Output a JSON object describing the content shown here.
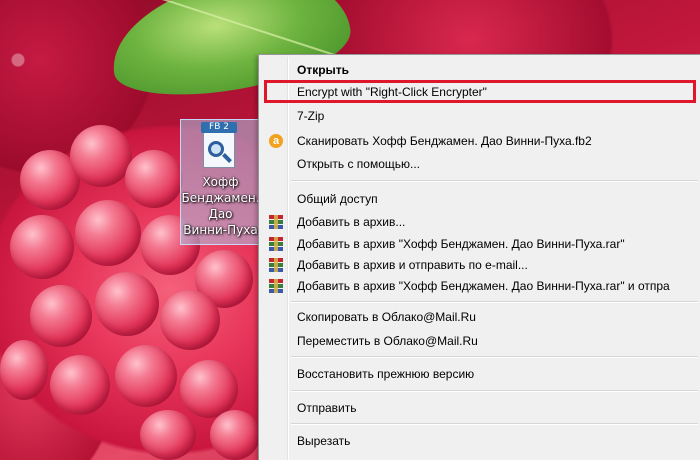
{
  "desktop": {
    "file": {
      "badge": "FB 2",
      "label": "Хофф\nБенджамен.\nДао\nВинни-Пуха"
    }
  },
  "context_menu": {
    "items": [
      {
        "label": "Открыть",
        "bold": true
      },
      {
        "label": "Encrypt with \"Right-Click Encrypter\""
      },
      {
        "label": "7-Zip"
      },
      {
        "label": "Сканировать Хофф Бенджамен. Дао Винни-Пуха.fb2",
        "icon": "avast-scan-icon"
      },
      {
        "label": "Открыть с помощью..."
      },
      {
        "label": "Общий доступ"
      },
      {
        "label": "Добавить в архив...",
        "icon": "winrar-icon"
      },
      {
        "label": "Добавить в архив \"Хофф Бенджамен. Дао Винни-Пуха.rar\"",
        "icon": "winrar-icon"
      },
      {
        "label": "Добавить в архив и отправить по e-mail...",
        "icon": "winrar-icon"
      },
      {
        "label": "Добавить в архив \"Хофф Бенджамен. Дао Винни-Пуха.rar\" и отпра",
        "icon": "winrar-icon"
      },
      {
        "label": "Скопировать в Облако@Mail.Ru"
      },
      {
        "label": "Переместить в Облако@Mail.Ru"
      },
      {
        "label": "Восстановить прежнюю версию"
      },
      {
        "label": "Отправить"
      },
      {
        "label": "Вырезать"
      }
    ]
  },
  "colors": {
    "highlight_border": "#e0162b",
    "menu_background": "#f0f0f0"
  }
}
